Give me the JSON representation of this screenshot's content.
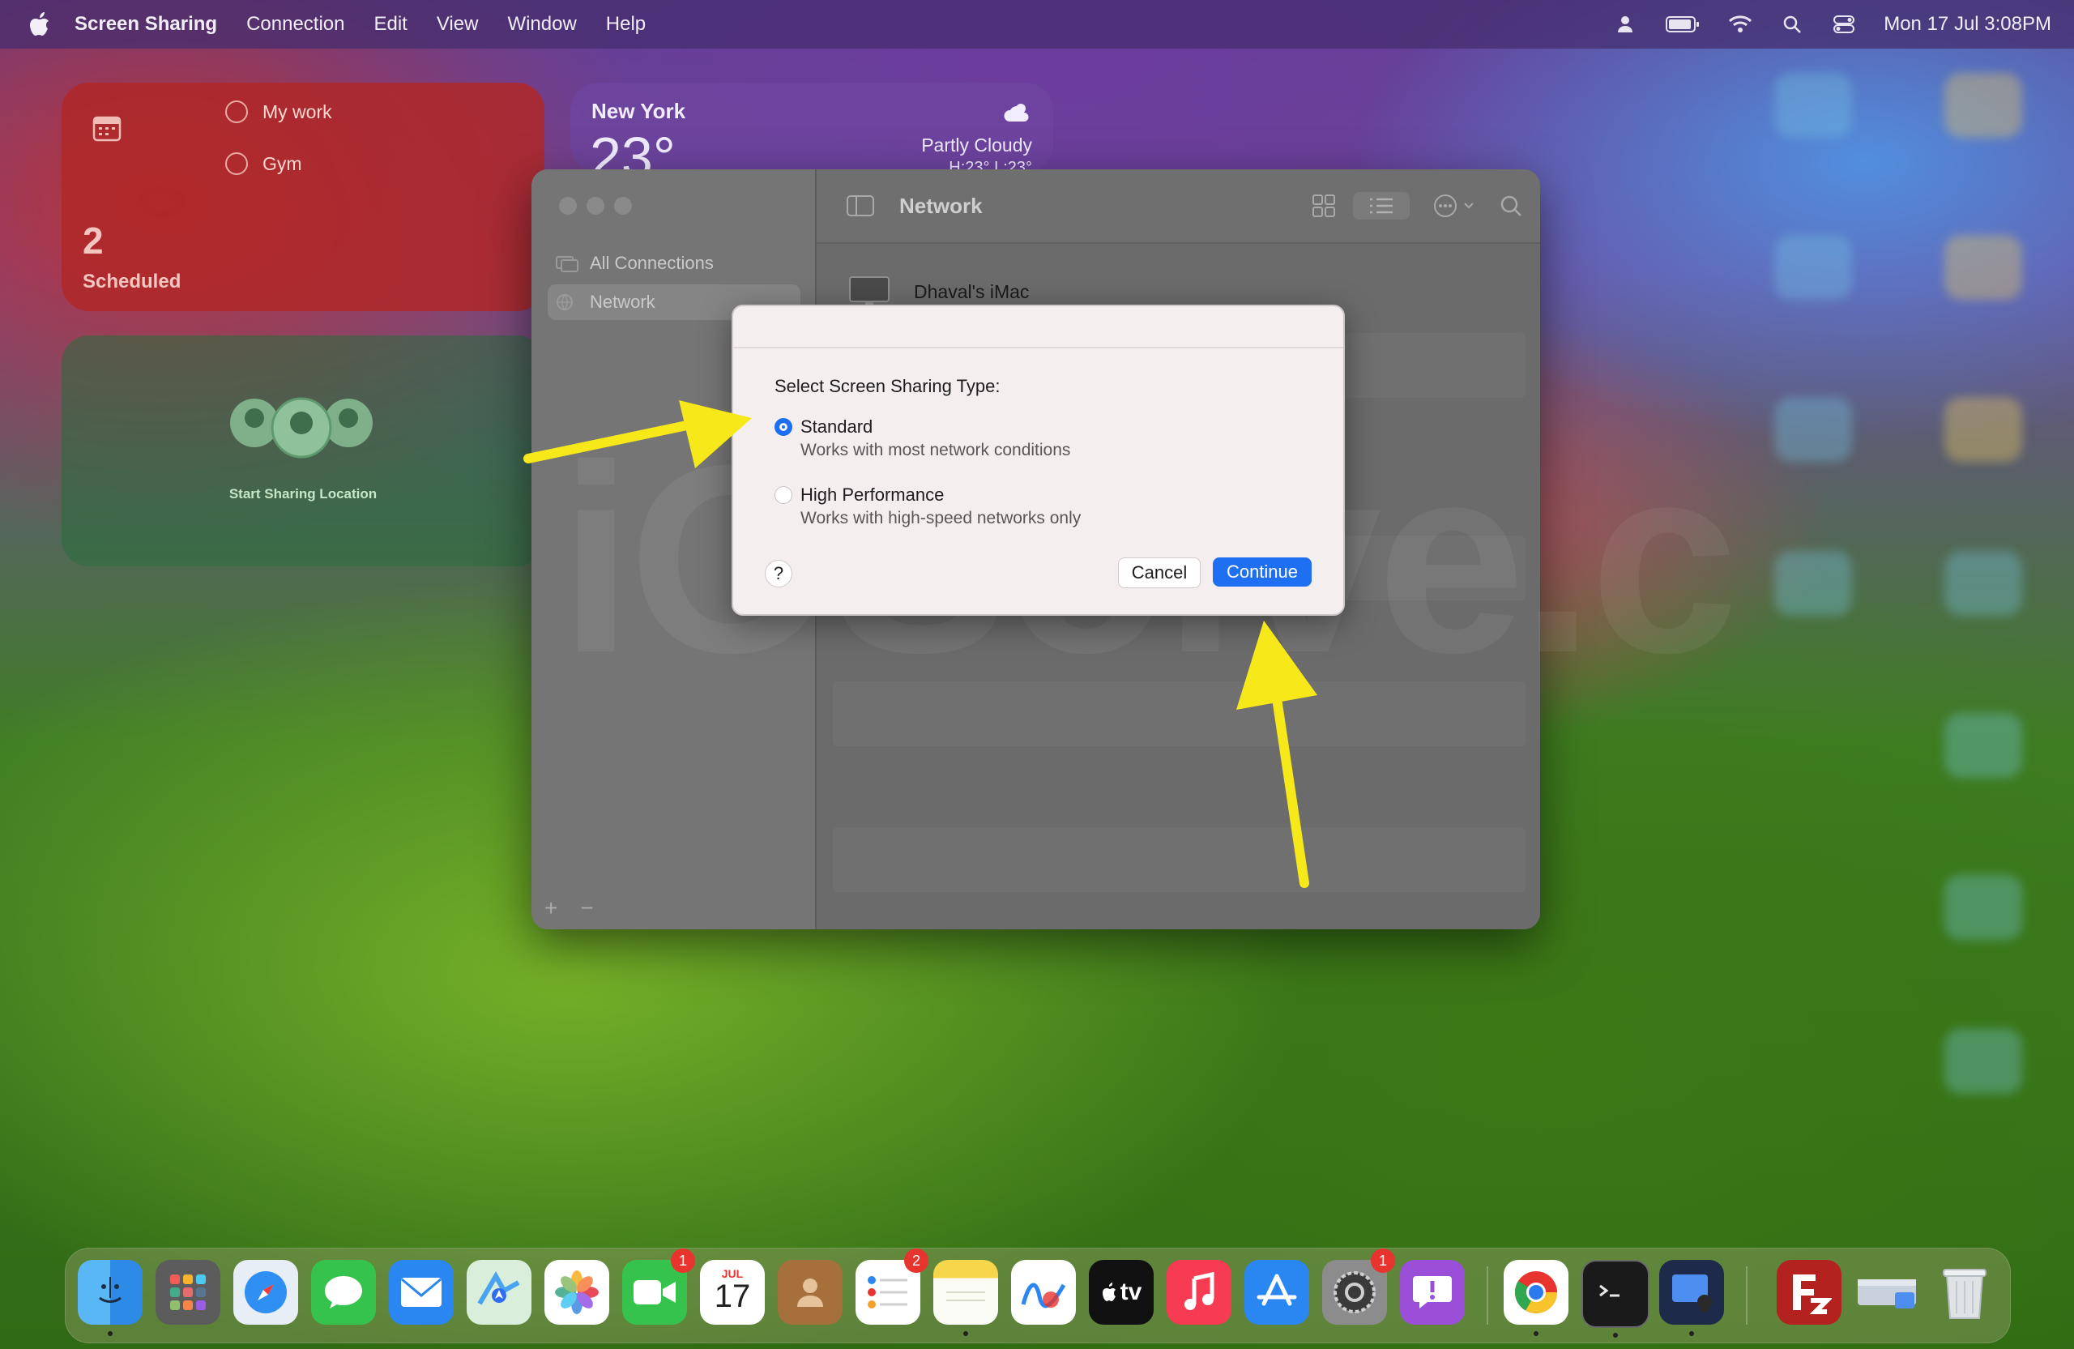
{
  "menubar": {
    "app_name": "Screen Sharing",
    "menus": [
      "Connection",
      "Edit",
      "View",
      "Window",
      "Help"
    ],
    "datetime": "Mon 17 Jul  3:08PM"
  },
  "widgets": {
    "reminders": {
      "items": [
        "My work",
        "Gym"
      ],
      "count": "2",
      "count_label": "Scheduled"
    },
    "weather": {
      "city": "New York",
      "temp": "23°",
      "condition": "Partly Cloudy",
      "hilo": "H:23° L:23°"
    },
    "findmy": {
      "label": "Start Sharing Location"
    }
  },
  "window": {
    "sidebar": {
      "items": [
        "All Connections",
        "Network"
      ],
      "add": "+",
      "remove": "−"
    },
    "toolbar": {
      "title": "Network"
    },
    "devices": [
      "Dhaval's iMac"
    ]
  },
  "dialog": {
    "title": "Select Screen Sharing Type:",
    "options": [
      {
        "label": "Standard",
        "description": "Works with most network conditions",
        "selected": true
      },
      {
        "label": "High Performance",
        "description": "Works with high-speed networks only",
        "selected": false
      }
    ],
    "help": "?",
    "cancel": "Cancel",
    "continue": "Continue"
  },
  "watermark": "iOSolve.c",
  "dock": {
    "badges": {
      "facetime": "1",
      "reminders": "2",
      "settings": "1"
    },
    "calendar_month": "JUL",
    "calendar_day": "17",
    "tv_label": "tv"
  },
  "colors": {
    "accent": "#1f6ff3",
    "arrow": "#f7e81a"
  }
}
